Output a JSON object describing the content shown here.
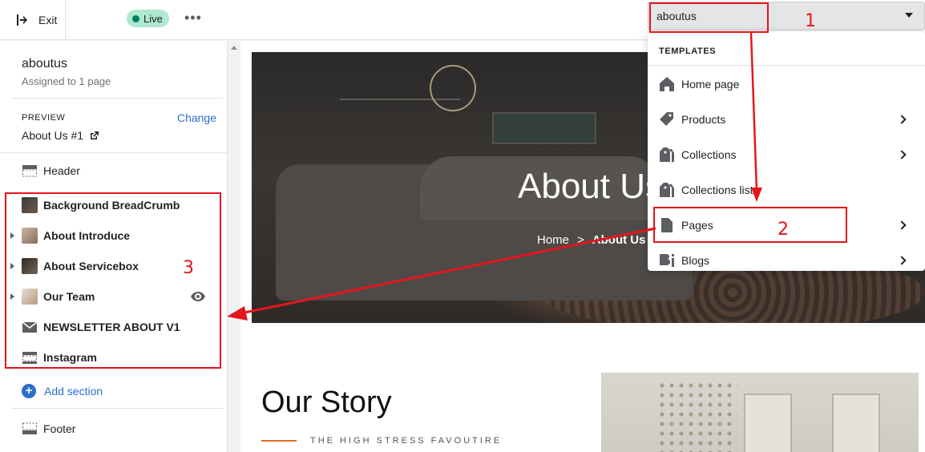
{
  "topbar": {
    "exit_label": "Exit",
    "status_label": "Live",
    "more_label": "•••"
  },
  "template_select": {
    "value": "aboutus"
  },
  "sidebar": {
    "template_name": "aboutus",
    "assigned_text": "Assigned to 1 page",
    "preview_heading": "PREVIEW",
    "change_label": "Change",
    "preview_value": "About Us #1",
    "header_label": "Header",
    "sections": [
      {
        "label": "Background BreadCrumb",
        "icon": "image-thumbnail"
      },
      {
        "label": "About Introduce",
        "icon": "image-thumbnail"
      },
      {
        "label": "About Servicebox",
        "icon": "image-thumbnail"
      },
      {
        "label": "Our Team",
        "icon": "image-thumbnail"
      },
      {
        "label": "NEWSLETTER ABOUT V1",
        "icon": "envelope-icon"
      },
      {
        "label": "Instagram",
        "icon": "section-icon"
      }
    ],
    "add_section_label": "Add section",
    "footer_label": "Footer"
  },
  "preview": {
    "hero_title": "About Us",
    "crumb_home": "Home",
    "crumb_separator": ">",
    "crumb_current": "About Us",
    "story_title": "Our Story",
    "story_subtitle": "THE HIGH STRESS FAVOUTIRE"
  },
  "dropdown": {
    "heading": "TEMPLATES",
    "items": [
      {
        "label": "Home page",
        "icon": "home-icon",
        "has_arrow": false
      },
      {
        "label": "Products",
        "icon": "tag-icon",
        "has_arrow": true
      },
      {
        "label": "Collections",
        "icon": "collections-icon",
        "has_arrow": true
      },
      {
        "label": "Collections list",
        "icon": "collections-icon",
        "has_arrow": false
      },
      {
        "label": "Pages",
        "icon": "page-icon",
        "has_arrow": true
      },
      {
        "label": "Blogs",
        "icon": "blog-icon",
        "has_arrow": true
      }
    ]
  },
  "annotations": {
    "step1": "1",
    "step2": "2",
    "step3": "3",
    "color": "#e4161c"
  },
  "colors": {
    "accent_link": "#2c6ecb",
    "live_badge": "#aee9d1",
    "live_dot": "#008060",
    "story_rule": "#e06a2d"
  }
}
